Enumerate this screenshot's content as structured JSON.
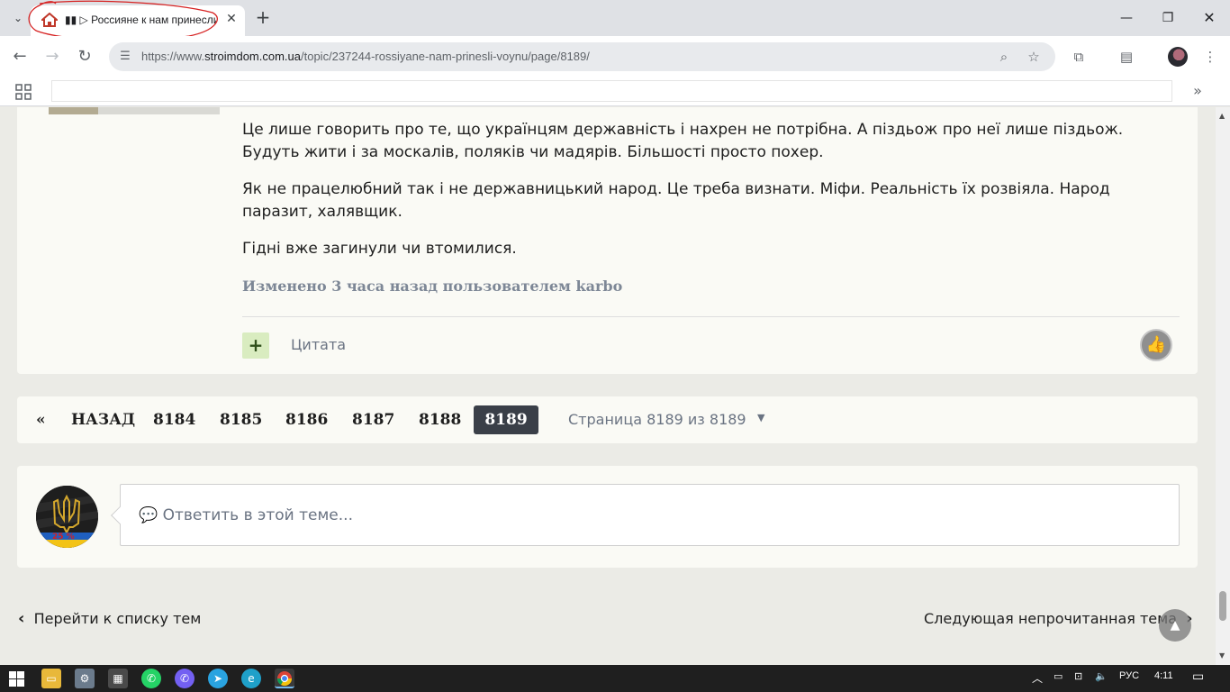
{
  "browser": {
    "tab_title": "▮▮ ▷ Россияне к нам принесли",
    "url_prefix": "https://www.",
    "url_domain": "stroimdom.com.ua",
    "url_path": "/topic/237244-rossiyane-nam-prinesli-voynu/page/8189/"
  },
  "post": {
    "paragraphs": [
      "Це лише говорить про те, що українцям державність і нахрен не потрібна. А піздьож про неї лише піздьож. Будуть жити і за москалів, поляків чи мадярів. Більшості просто похер.",
      "Як не працелюбний так і не державницький народ. Це треба визнати. Міфи. Реальність їх розвіяла. Народ паразит, халявщик.",
      "Гідні вже загинули чи втомилися."
    ],
    "edited_note": "Изменено 3 часа назад пользователем karbo",
    "plus_label": "+",
    "quote_label": "Цитата"
  },
  "pagination": {
    "first_label": "«",
    "prev_label": "НАЗАД",
    "pages": [
      "8184",
      "8185",
      "8186",
      "8187",
      "8188"
    ],
    "current_page": "8189",
    "page_jump": "Страница 8189 из 8189"
  },
  "reply": {
    "placeholder": "💬 Ответить в этой теме..."
  },
  "avatar": {
    "badge_text": "25 %"
  },
  "bottom_nav": {
    "back_to_list": "Перейти к списку тем",
    "next_unread": "Следующая непрочитанная тема"
  },
  "taskbar": {
    "language": "РУС",
    "time": "4:11"
  },
  "colors": {
    "accent_dark": "#3a3f48",
    "muted_text": "#6a7382",
    "plus_bg": "#d9ecc0"
  }
}
